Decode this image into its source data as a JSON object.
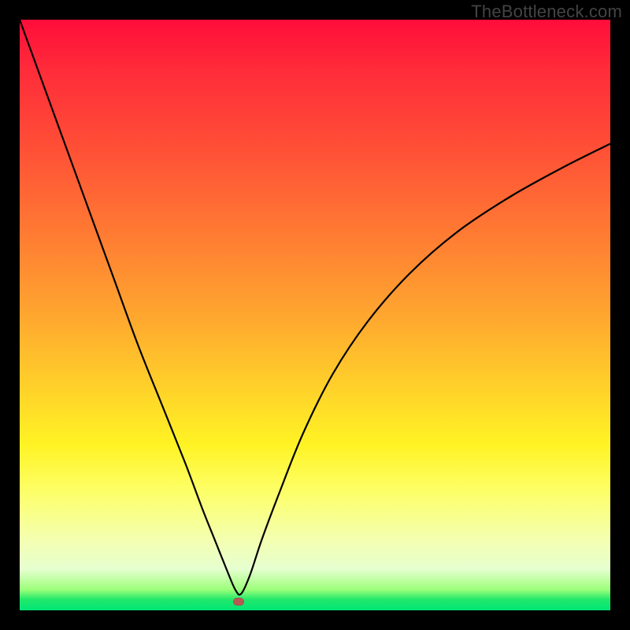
{
  "watermark": "TheBottleneck.com",
  "chart_data": {
    "type": "line",
    "title": "",
    "xlabel": "",
    "ylabel": "",
    "xlim": [
      0,
      100
    ],
    "ylim": [
      0,
      100
    ],
    "grid": false,
    "legend": false,
    "annotations": [],
    "marker": {
      "x": 37,
      "y": 1.5,
      "color": "#b35a52"
    },
    "series": [
      {
        "name": "curve",
        "x": [
          0,
          4,
          8,
          12,
          16,
          20,
          24,
          28,
          31,
          33,
          35,
          36.5,
          37.5,
          39,
          41,
          44,
          48,
          53,
          59,
          66,
          74,
          83,
          92,
          100
        ],
        "values": [
          100,
          89,
          78,
          67,
          56,
          45,
          35,
          25,
          17,
          12,
          7,
          3.5,
          2.8,
          6,
          12,
          20,
          30,
          40,
          49,
          57,
          64,
          70,
          75,
          79
        ]
      }
    ],
    "background_gradient": {
      "stops": [
        {
          "pos": 0,
          "color": "#ff0d3a"
        },
        {
          "pos": 50,
          "color": "#ffa62f"
        },
        {
          "pos": 72,
          "color": "#fff324"
        },
        {
          "pos": 100,
          "color": "#00e676"
        }
      ]
    }
  }
}
